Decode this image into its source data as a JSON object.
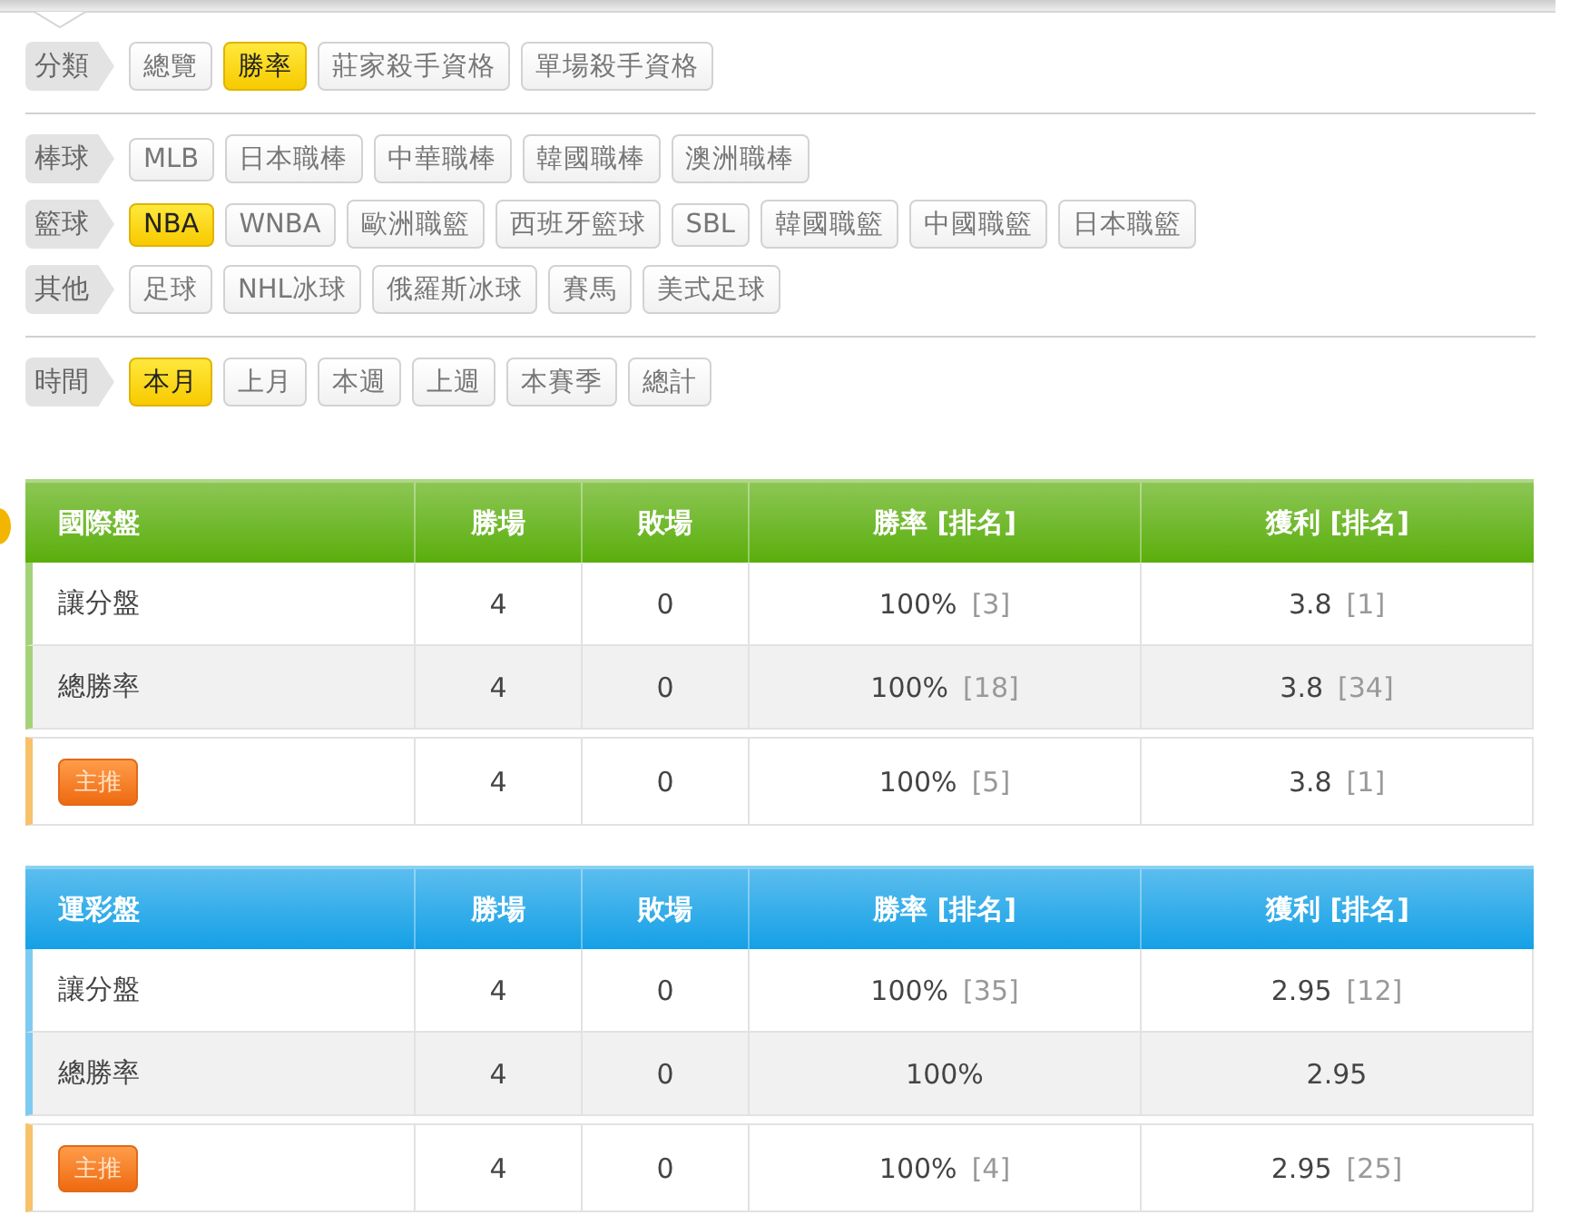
{
  "filter_groups": [
    [
      {
        "label": "分類",
        "options": [
          {
            "label": "總覽",
            "selected": false
          },
          {
            "label": "勝率",
            "selected": true
          },
          {
            "label": "莊家殺手資格",
            "selected": false
          },
          {
            "label": "單場殺手資格",
            "selected": false
          }
        ]
      }
    ],
    [
      {
        "label": "棒球",
        "options": [
          {
            "label": "MLB",
            "selected": false
          },
          {
            "label": "日本職棒",
            "selected": false
          },
          {
            "label": "中華職棒",
            "selected": false
          },
          {
            "label": "韓國職棒",
            "selected": false
          },
          {
            "label": "澳洲職棒",
            "selected": false
          }
        ]
      },
      {
        "label": "籃球",
        "options": [
          {
            "label": "NBA",
            "selected": true
          },
          {
            "label": "WNBA",
            "selected": false
          },
          {
            "label": "歐洲職籃",
            "selected": false
          },
          {
            "label": "西班牙籃球",
            "selected": false
          },
          {
            "label": "SBL",
            "selected": false
          },
          {
            "label": "韓國職籃",
            "selected": false
          },
          {
            "label": "中國職籃",
            "selected": false
          },
          {
            "label": "日本職籃",
            "selected": false
          }
        ]
      },
      {
        "label": "其他",
        "options": [
          {
            "label": "足球",
            "selected": false
          },
          {
            "label": "NHL冰球",
            "selected": false
          },
          {
            "label": "俄羅斯冰球",
            "selected": false
          },
          {
            "label": "賽馬",
            "selected": false
          },
          {
            "label": "美式足球",
            "selected": false
          }
        ]
      }
    ],
    [
      {
        "label": "時間",
        "options": [
          {
            "label": "本月",
            "selected": true
          },
          {
            "label": "上月",
            "selected": false
          },
          {
            "label": "本週",
            "selected": false
          },
          {
            "label": "上週",
            "selected": false
          },
          {
            "label": "本賽季",
            "selected": false
          },
          {
            "label": "總計",
            "selected": false
          }
        ]
      }
    ]
  ],
  "tables": [
    {
      "color": "#5aae0c",
      "columns": [
        "國際盤",
        "勝場",
        "敗場",
        "勝率 [排名]",
        "獲利 [排名]"
      ],
      "rows": [
        {
          "kind": "plain",
          "label": "讓分盤",
          "wins": "4",
          "losses": "0",
          "rate": "100%",
          "rate_rank": "[3]",
          "profit": "3.8",
          "profit_rank": "[1]"
        },
        {
          "kind": "plain",
          "label": "總勝率",
          "wins": "4",
          "losses": "0",
          "rate": "100%",
          "rate_rank": "[18]",
          "profit": "3.8",
          "profit_rank": "[34]"
        },
        {
          "kind": "featured",
          "label": "主推",
          "wins": "4",
          "losses": "0",
          "rate": "100%",
          "rate_rank": "[5]",
          "profit": "3.8",
          "profit_rank": "[1]"
        }
      ]
    },
    {
      "color": "#14a0e6",
      "columns": [
        "運彩盤",
        "勝場",
        "敗場",
        "勝率 [排名]",
        "獲利 [排名]"
      ],
      "rows": [
        {
          "kind": "plain",
          "label": "讓分盤",
          "wins": "4",
          "losses": "0",
          "rate": "100%",
          "rate_rank": "[35]",
          "profit": "2.95",
          "profit_rank": "[12]"
        },
        {
          "kind": "plain",
          "label": "總勝率",
          "wins": "4",
          "losses": "0",
          "rate": "100%",
          "profit": "2.95"
        },
        {
          "kind": "featured",
          "label": "主推",
          "wins": "4",
          "losses": "0",
          "rate": "100%",
          "rate_rank": "[4]",
          "profit": "2.95",
          "profit_rank": "[25]"
        }
      ]
    }
  ]
}
